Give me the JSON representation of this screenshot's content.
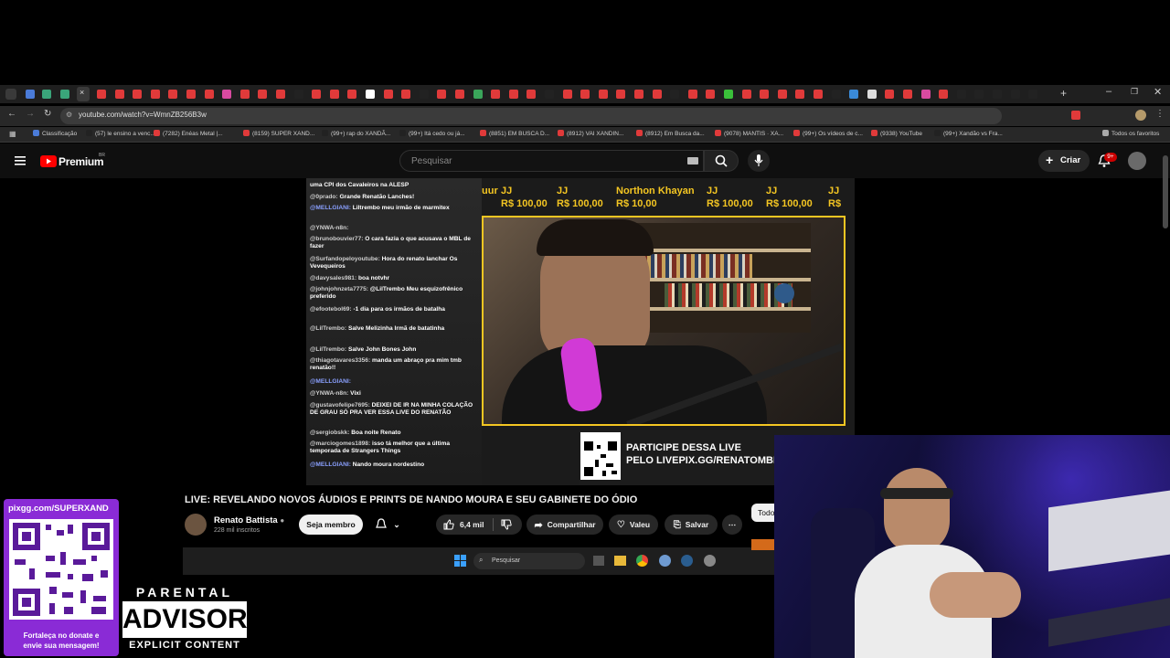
{
  "browser": {
    "url": "youtube.com/watch?v=WmnZB256B3w",
    "bookmarks": [
      "Classificação",
      "(57) le ensino a venc...",
      "(7282) Enéas Metal |...",
      "(8159) SUPER XAND...",
      "(99+) rap do XANDÃ...",
      "(99+) Itá cedo ou já...",
      "(8851) EM BUSCA D...",
      "(8912) VAI XANDIN...",
      "(8912) Em Busca da...",
      "(9078) MANTIS · XA...",
      "(99+) Os vídeos de c...",
      "(9338) YouTube",
      "(99+) Xandão vs Fra..."
    ],
    "all_favorites": "Todos os favoritos"
  },
  "youtube": {
    "logo": "Premium",
    "logo_badge": "BR",
    "search_placeholder": "Pesquisar",
    "create_label": "Criar",
    "notif_count": "9+"
  },
  "video": {
    "ticker": [
      {
        "name": "JJ",
        "amount": "R$ 100,00"
      },
      {
        "name": "JJ",
        "amount": "R$ 100,00"
      },
      {
        "name": "Northon Khayan",
        "amount": "R$ 10,00"
      },
      {
        "name": "JJ",
        "amount": "R$ 100,00"
      },
      {
        "name": "JJ",
        "amount": "R$ 100,00"
      },
      {
        "name": "JJ",
        "amount": "R$"
      }
    ],
    "ticker_partial": "uur",
    "chat": [
      {
        "user": "",
        "text": "uma CPI dos Cavaleiros na ALESP"
      },
      {
        "user": "@0prado:",
        "text": "Grande Renatão Lanches!"
      },
      {
        "user": "@MELLGIANI:",
        "text": "Liltrembo meu irmão de marmitex"
      },
      {
        "user": "@YNWA-n8n:",
        "text": ""
      },
      {
        "user": "@brunobouvier77:",
        "text": "O cara fazia o que acusava o MBL de fazer"
      },
      {
        "user": "@Surfandopeloyoutube:",
        "text": "Hora do renato lanchar Os Vevequeiros"
      },
      {
        "user": "@davysales981:",
        "text": "boa notvhr"
      },
      {
        "user": "@johnjohnzeta7775:",
        "text": "@LilTrembo Meu esquizofrênico preferido"
      },
      {
        "user": "@efootebol69:",
        "text": "-1 dia para os irmãos de batalha"
      },
      {
        "user": "@LilTrembo:",
        "text": "Salve Melizinha Irmã de batatinha"
      },
      {
        "user": "@LilTrembo:",
        "text": "Salve John Bones John"
      },
      {
        "user": "@thiagotavares3356:",
        "text": "manda um abraço pra mim tmb renatão!!"
      },
      {
        "user": "@MELLGIANI:",
        "text": ""
      },
      {
        "user": "@YNWA-n8n:",
        "text": "Vixi"
      },
      {
        "user": "@gustavofelipe7695:",
        "text": "DEIXEI DE IR NA MINHA COLAÇÃO DE GRAU SÓ PRA VER ESSA LIVE DO RENATÃO"
      },
      {
        "user": "@sergiobskk:",
        "text": "Boa noite Renato"
      },
      {
        "user": "@marciogomes1898:",
        "text": "isso tá melhor que a última temporada de Strangers Things"
      },
      {
        "user": "@MELLGIANI:",
        "text": "Nando moura nordestino"
      }
    ],
    "promo_line1": "PARTICIPE DESSA LIVE",
    "promo_line2": "PELO LIVEPIX.GG/RENATOMBL"
  },
  "watch": {
    "title": "LIVE: REVELANDO NOVOS ÁUDIOS E PRINTS DE NANDO MOURA E SEU GABINETE DO ÓDIO",
    "channel": "Renato Battista",
    "subscribers": "228 mil inscritos",
    "member_label": "Seja membro",
    "likes": "6,4 mil",
    "share_label": "Compartilhar",
    "thanks_label": "Valeu",
    "save_label": "Salvar",
    "side_chip": "Todo"
  },
  "taskbar": {
    "search_placeholder": "Pesquisar"
  },
  "overlay": {
    "pix_url": "pixgg.com/SUPERXAND",
    "pix_caption1": "Fortaleça no donate e",
    "pix_caption2": "envie sua mensagem!",
    "pa_line1": "PARENTAL",
    "pa_line2": "ADVISORY",
    "pa_line3": "EXPLICIT CONTENT"
  }
}
